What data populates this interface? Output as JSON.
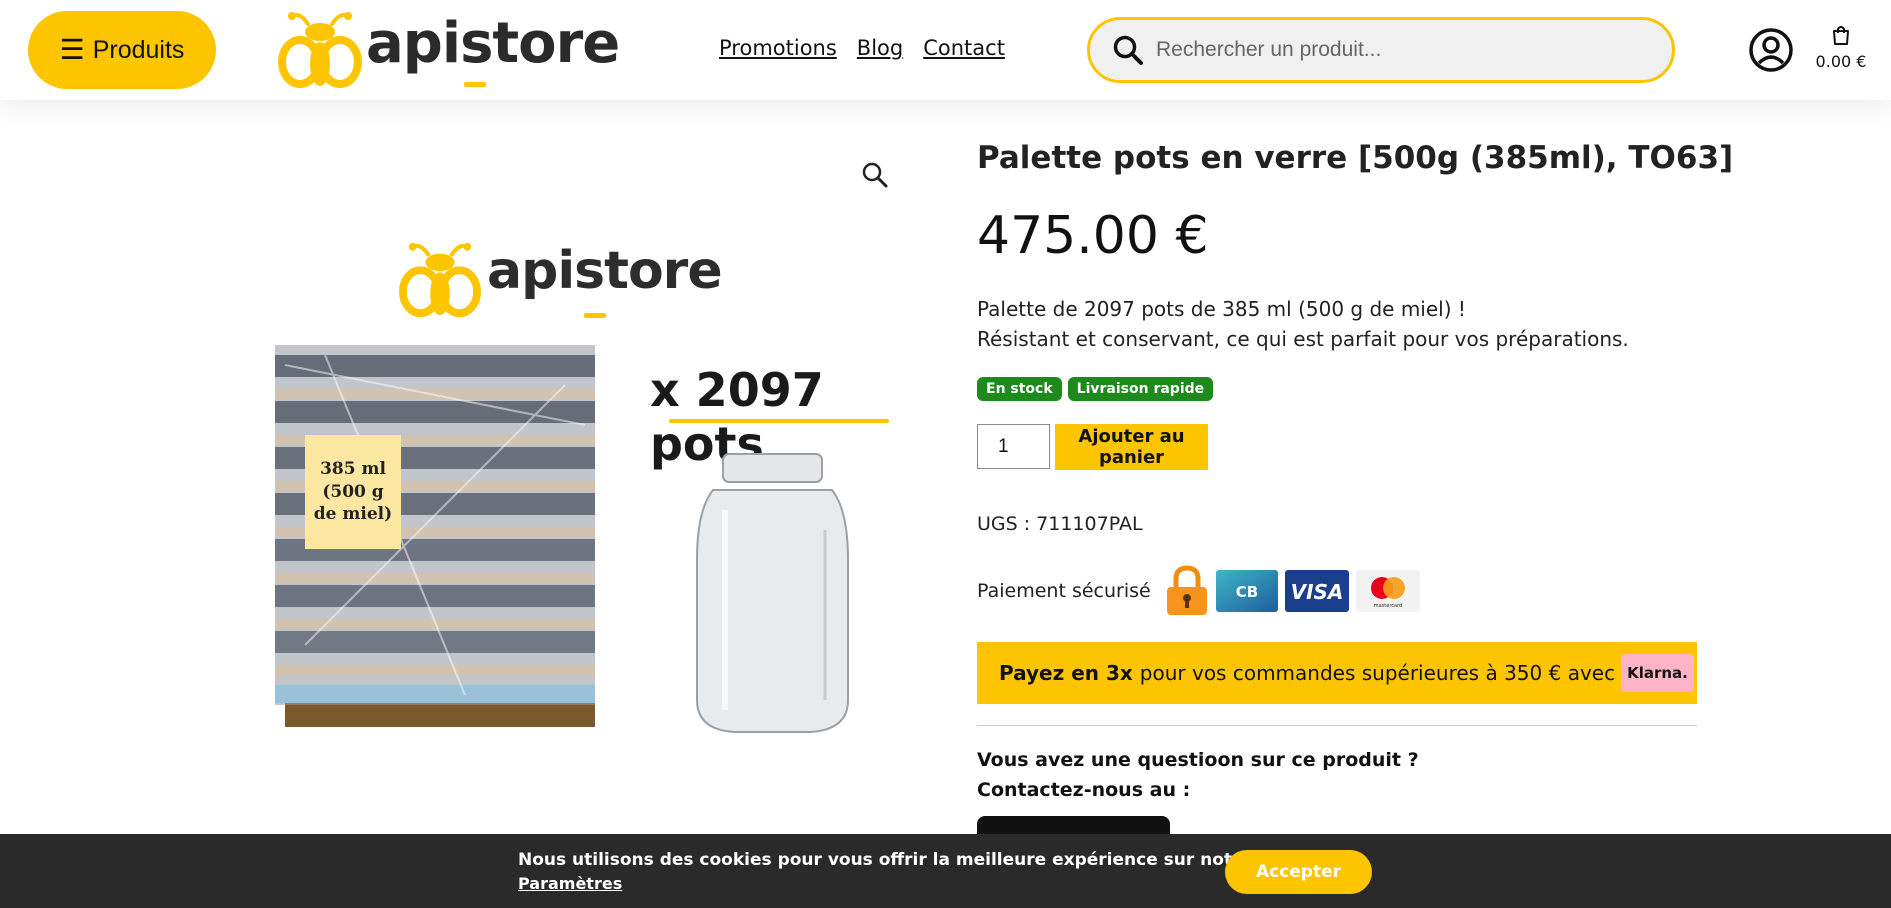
{
  "header": {
    "menu_label": "Produits",
    "logo_text": "apistore",
    "nav": [
      "Promotions",
      "Blog",
      "Contact"
    ],
    "search_placeholder": "Rechercher un produit...",
    "cart_amount": "0.00 €"
  },
  "product": {
    "image_logo_text": "apistore",
    "image_pots_label": "x 2097 pots",
    "image_jar_label": "385 ml (500 g de miel)",
    "title": "Palette pots en verre [500g (385ml), TO63]",
    "price": "475.00 €",
    "description_line1": "Palette de 2097 pots de 385 ml (500 g de miel) !",
    "description_line2": "Résistant et conservant, ce qui est parfait pour vos préparations.",
    "badges": [
      "En stock",
      "Livraison rapide"
    ],
    "quantity": "1",
    "add_to_cart_label": "Ajouter au panier",
    "sku": "UGS : 711107PAL",
    "payment_label": "Paiement sécurisé",
    "payment_logos": {
      "cb": "CB",
      "visa": "VISA",
      "mastercard": "mastercard"
    },
    "klarna_strong": "Payez en 3x",
    "klarna_text": "pour vos commandes supérieures à 350 € avec",
    "klarna_logo": "Klarna.",
    "question_line1": "Vous avez une questioon sur ce produit ?",
    "question_line2": "Contactez-nous au :"
  },
  "cookie": {
    "message": "Nous utilisons des cookies pour vous offrir la meilleure expérience sur notre site.",
    "settings_link": "Paramètres",
    "accept_label": "Accepter"
  },
  "colors": {
    "accent": "#fdc500",
    "stock_badge": "#1e8a1e",
    "cookie_bg": "#2a2a2a",
    "klarna_pink": "#ffb3c7"
  },
  "icons": [
    "menu-icon",
    "bee-logo-icon",
    "search-icon",
    "account-icon",
    "cart-icon",
    "zoom-icon",
    "lock-icon",
    "cb-card-icon",
    "visa-card-icon",
    "mastercard-icon"
  ]
}
